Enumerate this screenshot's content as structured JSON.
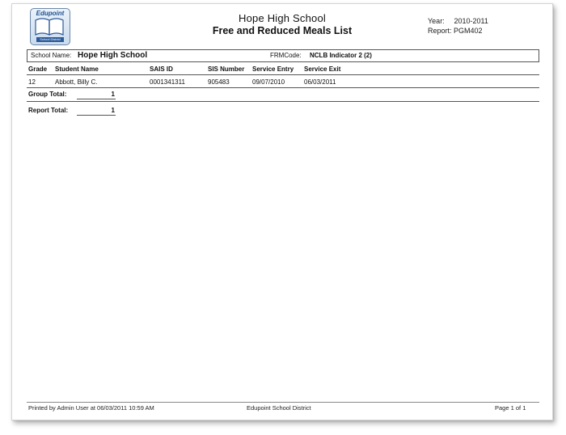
{
  "logo": {
    "brand": "Edupoint",
    "sub": "School District"
  },
  "report": {
    "school_title": "Hope High School",
    "list_title": "Free and Reduced Meals List",
    "year_label": "Year:",
    "year_value": "2010-2011",
    "report_label": "Report:",
    "report_value": "PGM402"
  },
  "header_box": {
    "school_label": "School Name:",
    "school_value": "Hope High School",
    "frm_label": "FRMCode:",
    "frm_value": "NCLB Indicator 2 (2)"
  },
  "table": {
    "columns": [
      "Grade",
      "Student Name",
      "SAIS ID",
      "SIS Number",
      "Service Entry",
      "Service Exit"
    ],
    "rows": [
      [
        "12",
        "Abbott, Billy C.",
        "0001341311",
        "905483",
        "09/07/2010",
        "06/03/2011"
      ]
    ]
  },
  "totals": {
    "group_label": "Group Total:",
    "group_value": "1",
    "report_label": "Report Total:",
    "report_value": "1"
  },
  "footer": {
    "printed_by": "Printed by Admin User at 06/03/2011 10:59 AM",
    "district": "Edupoint School District",
    "page": "Page 1 of 1"
  }
}
